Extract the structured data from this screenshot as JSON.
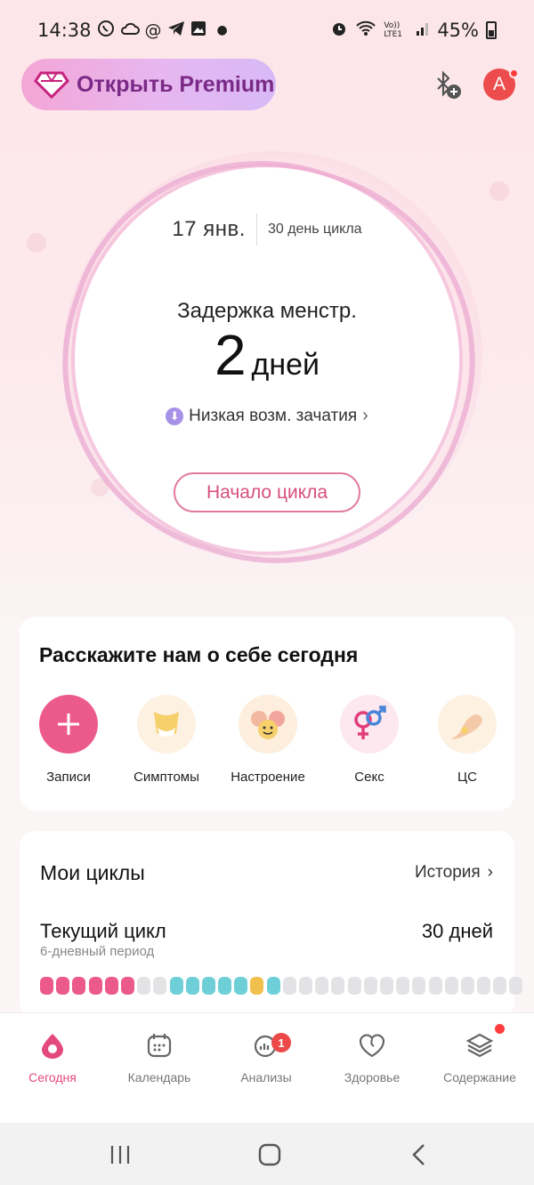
{
  "status_bar": {
    "time": "14:38",
    "notification_icons": [
      "whatsapp-icon",
      "cloud-icon",
      "at-icon",
      "telegram-icon",
      "gallery-icon",
      "dot-icon"
    ],
    "network_label": "Vo)) LTE1",
    "battery": "45%"
  },
  "header": {
    "premium_label": "Открыть Premium",
    "avatar_letter": "A"
  },
  "cycle_circle": {
    "date": "17 янв.",
    "cycle_day": "30 день цикла",
    "delay_label": "Задержка менстр.",
    "delay_number": "2",
    "delay_unit": "дней",
    "chance_label": "Низкая возм. зачатия",
    "start_button": "Начало цикла"
  },
  "tell_card": {
    "title": "Расскажите нам о себе сегодня",
    "actions": [
      {
        "label": "Записи",
        "icon": "plus-icon"
      },
      {
        "label": "Симптомы",
        "icon": "body-icon"
      },
      {
        "label": "Настроение",
        "icon": "mood-faces-icon"
      },
      {
        "label": "Секс",
        "icon": "gender-symbols-icon"
      },
      {
        "label": "ЦС",
        "icon": "cervical-mucus-icon"
      }
    ]
  },
  "cycles_card": {
    "title": "Мои циклы",
    "history_label": "История",
    "current_title": "Текущий цикл",
    "current_days": "30 дней",
    "period_label": "6-дневный период",
    "day_dots": [
      "period",
      "period",
      "period",
      "period",
      "period",
      "period",
      "normal",
      "normal",
      "fertile",
      "fertile",
      "fertile",
      "fertile",
      "fertile",
      "ovulation",
      "fertile",
      "normal",
      "normal",
      "normal",
      "normal",
      "normal",
      "normal",
      "normal",
      "normal",
      "normal",
      "normal",
      "normal",
      "normal",
      "normal",
      "normal",
      "normal"
    ],
    "colors": {
      "period": "#ec5a8c",
      "normal": "#e3e3e6",
      "fertile": "#6fcfd8",
      "ovulation": "#f1c04c"
    }
  },
  "tabs": [
    {
      "label": "Сегодня",
      "icon": "today-drop-icon",
      "active": true
    },
    {
      "label": "Календарь",
      "icon": "calendar-icon",
      "active": false
    },
    {
      "label": "Анализы",
      "icon": "analysis-chart-icon",
      "active": false,
      "badge": "1"
    },
    {
      "label": "Здоровье",
      "icon": "heart-icon",
      "active": false
    },
    {
      "label": "Содержание",
      "icon": "layers-icon",
      "active": false
    }
  ],
  "accent_color": "#e4497b"
}
